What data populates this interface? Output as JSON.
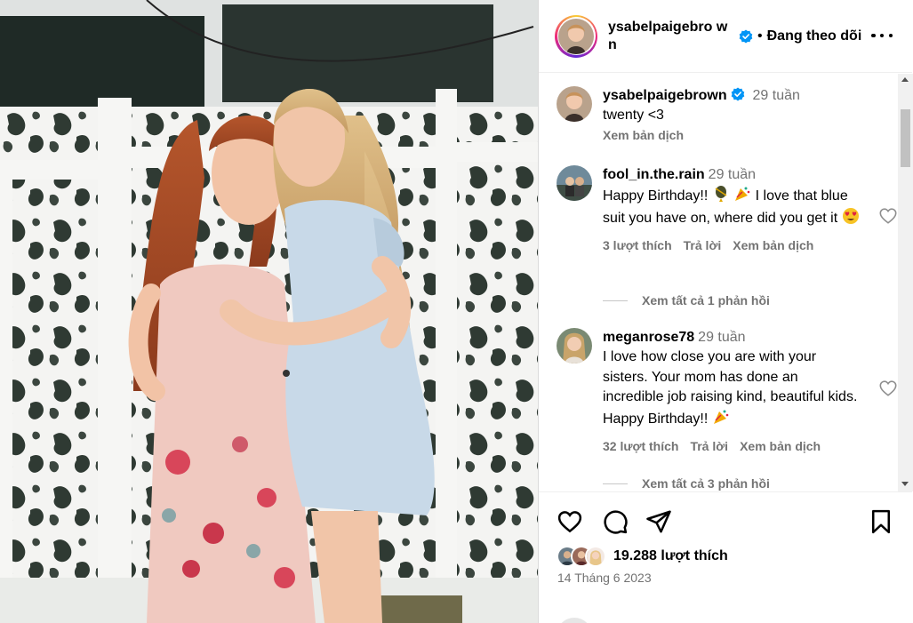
{
  "post": {
    "author": "ysabelpaigebrown",
    "author_display": "ysabelpaigebro wn",
    "follow_status": "Đang theo dõi",
    "dot": "•",
    "likes": "19.288 lượt thích",
    "date": "14 Tháng 6 2023"
  },
  "caption": {
    "user": "ysabelpaigebrown",
    "time": "29 tuần",
    "text": "twenty <3",
    "translate": "Xem bản dịch"
  },
  "comments": [
    {
      "user": "fool_in.the.rain",
      "time": "29 tuần",
      "text_1": "Happy Birthday!!",
      "text_2": "I love that blue suit you have on, where did you get it",
      "likes": "3 lượt thích",
      "reply": "Trả lời",
      "translate": "Xem bản dịch",
      "view_replies": "Xem tất cả 1 phản hồi"
    },
    {
      "user": "meganrose78",
      "time": "29 tuần",
      "text_1": "I love how close you are with your sisters. Your mom has done an incredible job raising kind, beautiful kids. Happy Birthday!!",
      "likes": "32 lượt thích",
      "reply": "Trả lời",
      "translate": "Xem bản dịch",
      "view_replies": "Xem tất cả 3 phản hồi"
    }
  ],
  "icons": {
    "like": "heart-icon",
    "comment": "comment-icon",
    "share": "send-icon",
    "save": "bookmark-icon",
    "more": "more-icon",
    "verified": "verified-badge-icon"
  },
  "colors": {
    "verified": "#0095f6",
    "muted_text": "#737373",
    "divider": "#efefef"
  }
}
